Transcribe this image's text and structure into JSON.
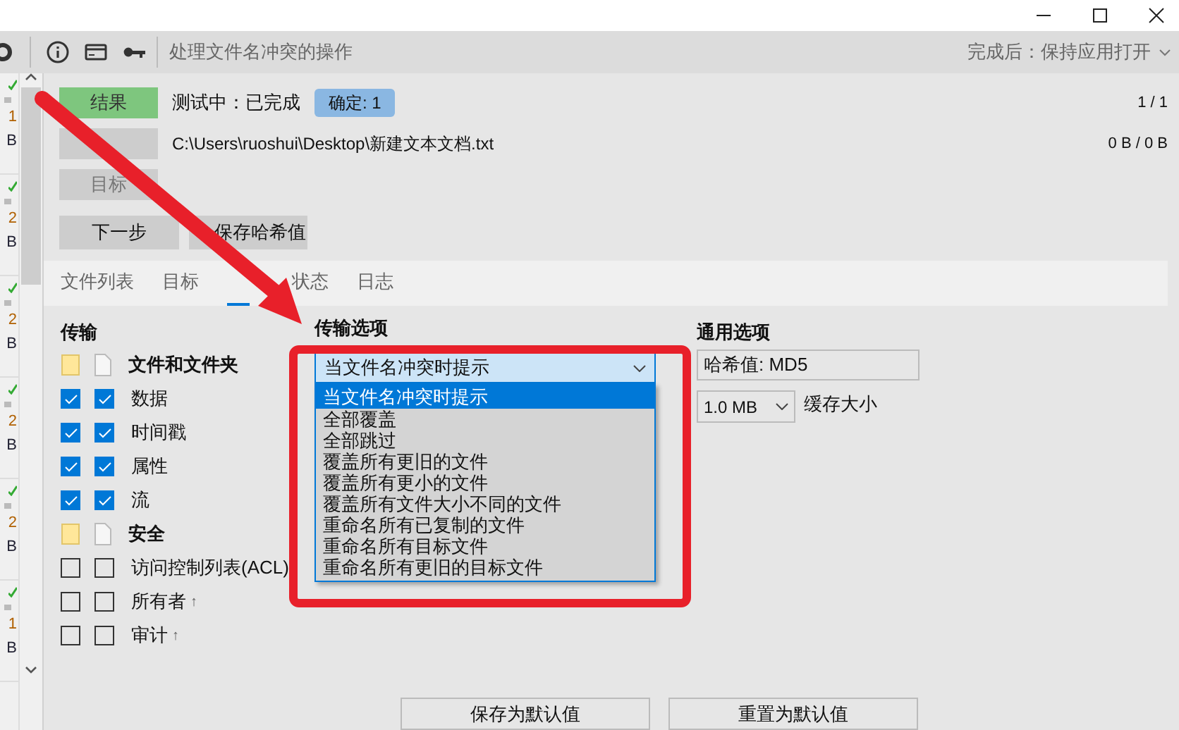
{
  "toolbar": {
    "title": "处理文件名冲突的操作",
    "after_complete": "完成后：保持应用打开"
  },
  "queue": [
    {
      "count": "1",
      "unit": "B",
      "done": true
    },
    {
      "count": "2",
      "unit": "B",
      "done": true
    },
    {
      "count": "2",
      "unit": "B",
      "done": true
    },
    {
      "count": "2",
      "unit": "B",
      "done": true
    },
    {
      "count": "2",
      "unit": "B",
      "done": true
    },
    {
      "count": "1",
      "unit": "B",
      "done": true
    }
  ],
  "side_buttons": [
    {
      "kind": "result",
      "label": "结果"
    },
    {
      "kind": "blank"
    },
    {
      "kind": "plain",
      "label": "目标"
    }
  ],
  "status": "测试中：已完成",
  "badge": "确定: 1",
  "file_count": "1 / 1",
  "path": "C:\\Users\\ruoshui\\Desktop\\新建文本文档.txt",
  "byte_count": "0 B / 0 B",
  "actions": [
    "下一步",
    "保存哈希值"
  ],
  "tabs": [
    {
      "label": "文件列表",
      "selected": false
    },
    {
      "label": "目标",
      "selected": false
    },
    {
      "selected": true
    },
    {
      "label": "状态",
      "selected": false
    },
    {
      "label": "日志",
      "selected": false
    }
  ],
  "transfer": {
    "title": "传输",
    "items": [
      {
        "kind": "group",
        "label": "文件和文件夹"
      },
      {
        "kind": "option",
        "label": "数据",
        "source_checked": true,
        "target_checked": true
      },
      {
        "kind": "option",
        "label": "时间戳",
        "source_checked": true,
        "target_checked": true
      },
      {
        "kind": "option",
        "label": "属性",
        "source_checked": true,
        "target_checked": true
      },
      {
        "kind": "option",
        "label": "流",
        "source_checked": true,
        "target_checked": true
      },
      {
        "kind": "group",
        "label": "安全"
      },
      {
        "kind": "option",
        "label": "访问控制列表(ACL)",
        "source_checked": false,
        "target_checked": false
      },
      {
        "kind": "option",
        "label": "所有者",
        "note": "↑",
        "source_checked": false,
        "target_checked": false
      },
      {
        "kind": "option",
        "label": "审计",
        "note": "↑",
        "source_checked": false,
        "target_checked": false
      }
    ]
  },
  "transfer_options": {
    "title": "传输选项",
    "conflict_select": {
      "value": "当文件名冲突时提示",
      "options": [
        {
          "label": "当文件名冲突时提示",
          "selected": true
        },
        {
          "label": "全部覆盖",
          "selected": false
        },
        {
          "label": "全部跳过",
          "selected": false
        },
        {
          "label": "覆盖所有更旧的文件",
          "selected": false
        },
        {
          "label": "覆盖所有更小的文件",
          "selected": false
        },
        {
          "label": "覆盖所有文件大小不同的文件",
          "selected": false
        },
        {
          "label": "重命名所有已复制的文件",
          "selected": false
        },
        {
          "label": "重命名所有目标文件",
          "selected": false
        },
        {
          "label": "重命名所有更旧的目标文件",
          "selected": false
        }
      ]
    }
  },
  "general_options": {
    "title": "通用选项",
    "hash": "哈希值: MD5",
    "buffer": {
      "value": "1.0 MB",
      "label": "缓存大小"
    }
  },
  "buttons": [
    "保存为默认值",
    "重置为默认值"
  ],
  "annotations": {
    "arrow": true,
    "frame": true
  }
}
